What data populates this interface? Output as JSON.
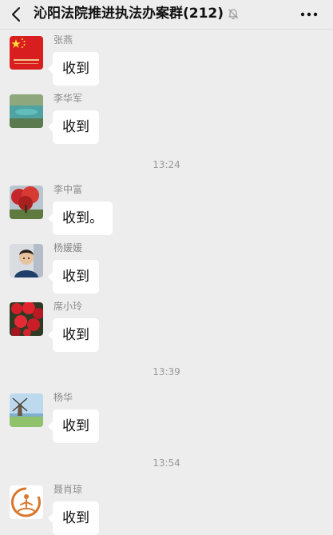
{
  "header": {
    "title": "沁阳法院推进执法办案群(212)",
    "back_icon": "chevron-left-icon",
    "mute_icon": "bell-off-icon",
    "more_icon": "ellipsis-icon"
  },
  "messages": [
    {
      "sender": "张燕",
      "text": "收到",
      "avatar": "flag-avatar"
    },
    {
      "sender": "李华军",
      "text": "收到",
      "avatar": "lake-avatar"
    },
    {
      "time": "13:24"
    },
    {
      "sender": "李中富",
      "text": "收到。",
      "avatar": "red-tree-avatar"
    },
    {
      "sender": "杨媛媛",
      "text": "收到",
      "avatar": "child-avatar"
    },
    {
      "sender": "席小玲",
      "text": "收到",
      "avatar": "red-flowers-avatar"
    },
    {
      "time": "13:39"
    },
    {
      "sender": "杨华",
      "text": "收到",
      "avatar": "windmill-avatar"
    },
    {
      "time": "13:54"
    },
    {
      "sender": "聂肖琼",
      "text": "收到",
      "avatar": "meditation-logo-avatar"
    }
  ],
  "colors": {
    "background": "#ededed",
    "bubble": "#ffffff",
    "sender_text": "#8a8a8a",
    "timestamp_text": "#9a9a9a"
  }
}
